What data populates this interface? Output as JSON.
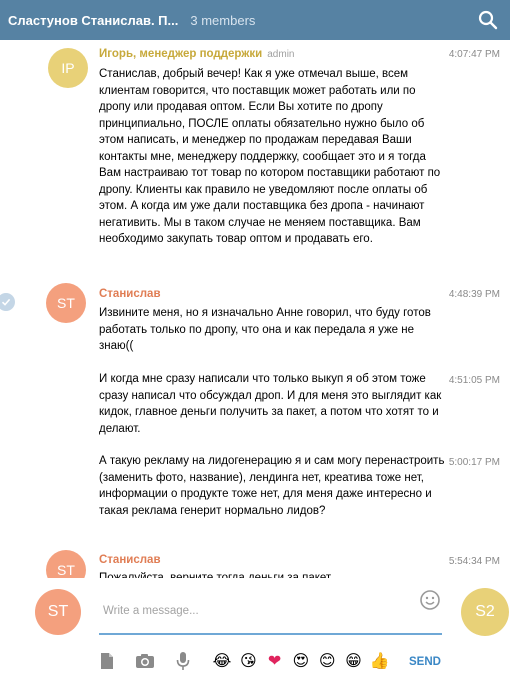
{
  "header": {
    "title": "Сластунов Станислав. П...",
    "members": "3 members",
    "search_icon": "search-icon"
  },
  "messages": [
    {
      "avatar": "IP",
      "author": "Игорь, менеджер поддержки",
      "role": "admin",
      "time": "4:07:47 PM",
      "text": "Станислав, добрый вечер! Как я уже отмечал выше, всем клиентам говорится, что поставщик может работать или по дропу или продавая оптом. Если Вы хотите по дропу принципиально, ПОСЛЕ оплаты обязательно нужно было об этом написать, и менеджер по продажам передавая Ваши контакты мне, менеджеру поддержку, сообщает это и я тогда Вам настраиваю тот товар по котором поставщики работают по дропу. Клиенты как правило не уведомляют после оплаты об этом. А когда им уже дали поставщика без дропа - начинают негативить. Мы в таком случае не меняем поставщика. Вам необходимо закупать товар оптом и продавать его."
    },
    {
      "avatar": "ST",
      "author": "Станислав",
      "time": "4:48:39 PM",
      "text": "Извините меня, но я изначально Анне говорил, что буду готов работать только по дропу, что она и как передала я уже не знаю(("
    },
    {
      "time": "4:51:05 PM",
      "text": "И когда мне сразу написали что только выкуп я об этом  тоже сразу написал что обсуждал дроп. И для меня это выглядит как кидок, главное деньги получить за пакет, а потом что хотят то и делают."
    },
    {
      "time": "5:00:17 PM",
      "text": "А такую рекламу на лидогенерацию я и сам могу перенастроить (заменить фото, название), лендинга нет, креатива тоже нет, информации о продукте тоже нет, для меня даже интересно и такая реклама генерит нормально лидов?"
    },
    {
      "avatar": "ST",
      "author": "Станислав",
      "time": "5:54:34 PM",
      "text": "Пожалуйста, верните тогда деньги за пакет"
    }
  ],
  "composer": {
    "placeholder": "Write a message...",
    "avatar_left": "ST",
    "avatar_right": "S2",
    "send_label": "SEND",
    "tools": [
      "file-icon",
      "camera-icon",
      "microphone-icon"
    ],
    "emojis": [
      "😂",
      "😘",
      "❤",
      "😍",
      "😊",
      "😁",
      "👍"
    ]
  },
  "colors": {
    "header": "#5682a3",
    "accent": "#3a87c5",
    "author_admin": "#c7a93b",
    "author_user": "#e07d54",
    "avatar_ip": "#e8d178",
    "avatar_st": "#f4a07e"
  }
}
